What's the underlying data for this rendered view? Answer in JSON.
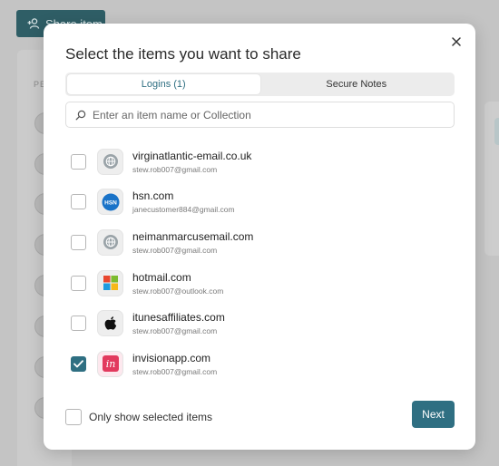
{
  "background": {
    "share_button_label": "Share item",
    "column_label": "PE"
  },
  "modal": {
    "title": "Select the items you want to share",
    "tabs": [
      {
        "label": "Logins (1)",
        "active": true
      },
      {
        "label": "Secure Notes",
        "active": false
      }
    ],
    "search": {
      "placeholder": "Enter an item name or Collection",
      "value": ""
    },
    "items": [
      {
        "name": "virginatlantic-email.co.uk",
        "user": "stew.rob007@gmail.com",
        "icon": "globe-icon",
        "checked": false
      },
      {
        "name": "hsn.com",
        "user": "janecustomer884@gmail.com",
        "icon": "hsn-logo-icon",
        "checked": false
      },
      {
        "name": "neimanmarcusemail.com",
        "user": "stew.rob007@gmail.com",
        "icon": "globe-icon",
        "checked": false
      },
      {
        "name": "hotmail.com",
        "user": "stew.rob007@outlook.com",
        "icon": "microsoft-logo-icon",
        "checked": false
      },
      {
        "name": "itunesaffiliates.com",
        "user": "stew.rob007@gmail.com",
        "icon": "apple-logo-icon",
        "checked": false
      },
      {
        "name": "invisionapp.com",
        "user": "stew.rob007@gmail.com",
        "icon": "invision-logo-icon",
        "checked": true
      }
    ],
    "hsn_logo_text": "HSN",
    "invision_logo_text": "in",
    "only_selected_label": "Only show selected items",
    "only_selected_checked": false,
    "next_label": "Next"
  },
  "colors": {
    "accent": "#2f6f82",
    "hsn_blue": "#1a73c8",
    "invision_pink": "#e23a5e"
  }
}
